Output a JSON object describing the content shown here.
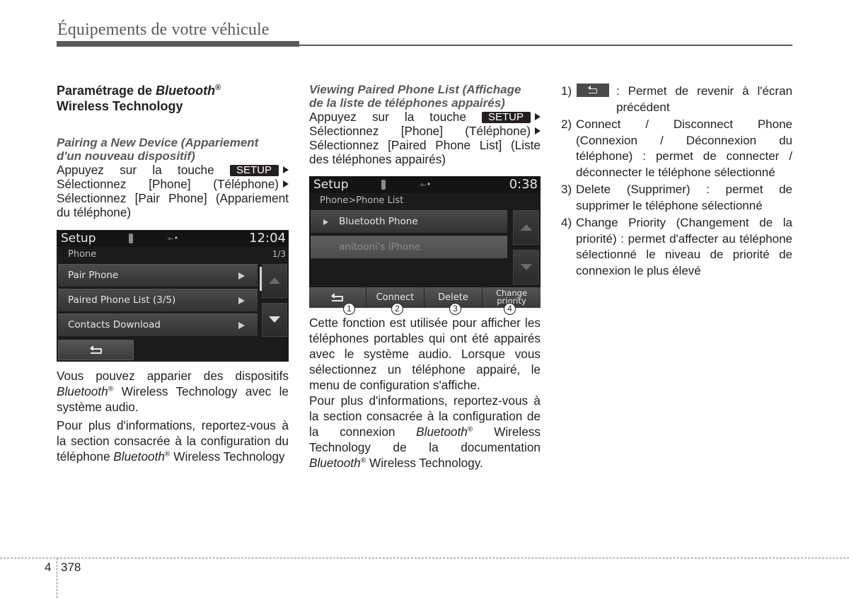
{
  "header": {
    "title": "Équipements de votre véhicule"
  },
  "col1": {
    "heading_line1_a": "Paramétrage de ",
    "heading_line1_b": "Bluetooth",
    "heading_line2": "Wireless Technology",
    "sub_line1": "Pairing a New Device (Appariement",
    "sub_line2": "d'un nouveau dispositif)",
    "steps": {
      "line1": "Appuyez sur la touche",
      "setup_key": "SETUP",
      "line2": "Sélectionnez [Phone] (Téléphone)",
      "line3": "Sélectionnez [Pair Phone] (Appariement du téléphone)"
    },
    "screen": {
      "title": "Setup",
      "time": "12:04",
      "subtitle": "Phone",
      "page": "1/3",
      "items": [
        {
          "label": "Pair Phone"
        },
        {
          "label": "Paired Phone List (3/5)"
        },
        {
          "label": "Contacts Download"
        }
      ]
    },
    "para1_a": "Vous pouvez apparier des dispositifs",
    "para1_b": "Bluetooth",
    "para1_c": " Wireless Technology avec le système audio.",
    "para2_a": "Pour plus d'informations, reportez-vous à la section consacrée à la configuration du téléphone ",
    "para2_b": "Bluetooth",
    "para2_c": " Wireless Technology"
  },
  "col2": {
    "sub_line1": "Viewing Paired Phone List (Affichage",
    "sub_line2": "de la liste de téléphones appairés)",
    "steps": {
      "line1": "Appuyez sur la touche",
      "setup_key": "SETUP",
      "line2": "Sélectionnez [Phone] (Téléphone)",
      "line3": "Sélectionnez [Paired Phone List] (Liste des téléphones appairés)"
    },
    "screen": {
      "title": "Setup",
      "time": "0:38",
      "subtitle": "Phone>Phone List",
      "items": [
        {
          "label": "Bluetooth Phone"
        },
        {
          "label": "anitooni's iPhone"
        }
      ],
      "buttons": [
        "Connect",
        "Delete",
        "Change priority"
      ],
      "callouts": [
        "1",
        "2",
        "3",
        "4"
      ]
    },
    "para1": "Cette fonction est utilisée pour afficher les téléphones portables qui ont été appairés avec le système audio. Lorsque vous sélectionnez un téléphone appairé, le menu de configuration s'affiche.",
    "para2_a": "Pour plus d'informations, reportez-vous à la section consacrée à la configuration de la connexion ",
    "para2_b": "Bluetooth",
    "para2_c": " Wireless Technology de la documentation ",
    "para2_d": "Bluetooth",
    "para2_e": " Wireless Technology."
  },
  "col3": {
    "items": [
      {
        "num": "1)",
        "text": ": Permet de revenir à l'écran précédent"
      },
      {
        "num": "2)",
        "text": "Connect / Disconnect Phone (Connexion / Déconnexion du téléphone) : permet de connecter / déconnecter le téléphone sélectionné"
      },
      {
        "num": "3)",
        "text": "Delete (Supprimer) : permet de supprimer le téléphone sélectionné"
      },
      {
        "num": "4)",
        "text": "Change Priority (Changement de la priorité) : permet d'affecter au téléphone sélectionné le niveau de priorité de connexion le plus élevé"
      }
    ]
  },
  "registered": "®",
  "footer": {
    "chapter": "4",
    "page": "378"
  }
}
